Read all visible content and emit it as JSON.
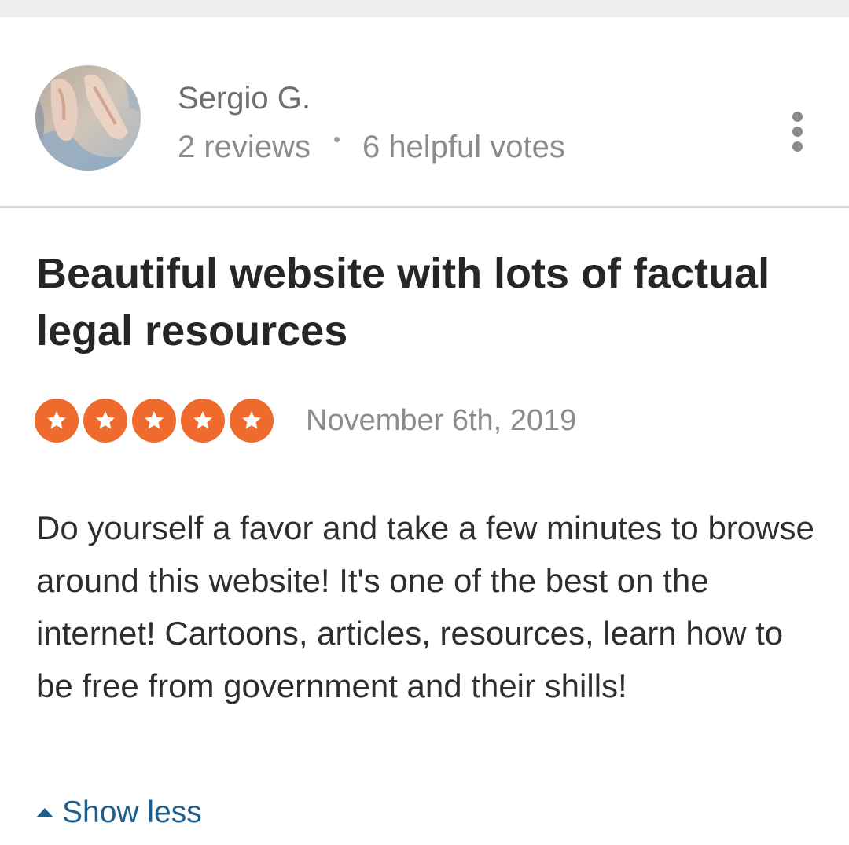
{
  "reviewer": {
    "name": "Sergio G.",
    "reviews": "2 reviews",
    "helpful_votes": "6 helpful votes",
    "avatar_icon": "user-avatar-photo"
  },
  "menu": {
    "icon": "more-vertical-icon"
  },
  "review": {
    "title": "Beautiful website with lots of factual legal resources",
    "rating": 5,
    "rating_max": 5,
    "date": "November 6th, 2019",
    "body": "Do yourself a favor and take a few minutes to browse around this website! It's one of the best on the internet! Cartoons, articles, resources, learn how to be free from government and their shills!"
  },
  "actions": {
    "show_less_label": "Show less",
    "show_less_icon": "caret-up-icon"
  },
  "colors": {
    "star_fill": "#ef6b2d",
    "star_glyph": "#ffffff",
    "link": "#1d5f8c",
    "title_text": "#262626",
    "meta_text": "#8c8c8c",
    "divider": "#d8d8d8"
  }
}
